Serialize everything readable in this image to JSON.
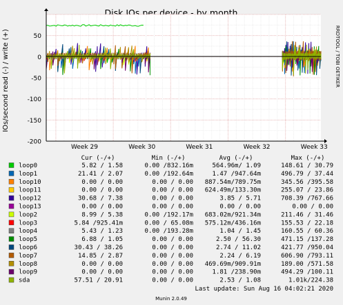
{
  "chart_data": {
    "type": "line",
    "title": "Disk IOs per device - by month",
    "ylabel": "IOs/second read (-) / write (+)",
    "side_label": "RRDTOOL / TOBI OETIKER",
    "ylim": [
      -200,
      100
    ],
    "yticks": [
      -200,
      -150,
      -100,
      -50,
      0,
      50
    ],
    "xticks": [
      "Week 29",
      "Week 30",
      "Week 31",
      "Week 32",
      "Week 33"
    ],
    "grid": true,
    "legend_header": {
      "cur": "Cur (-/+)",
      "min": "Min (-/+)",
      "avg": "Avg (-/+)",
      "max": "Max (-/+)"
    },
    "series": [
      {
        "name": "loop0",
        "color": "#00cc00",
        "cur": "5.82 / 1.58",
        "min": "0.00 /832.16m",
        "avg": "564.96m/ 1.09",
        "max": "148.61 / 30.79"
      },
      {
        "name": "loop1",
        "color": "#0066b3",
        "cur": "21.41 / 2.07",
        "min": "0.00 /192.64m",
        "avg": "1.47 /947.64m",
        "max": "496.79 / 37.44"
      },
      {
        "name": "loop10",
        "color": "#ff8000",
        "cur": "0.00 / 0.00",
        "min": "0.00 / 0.00",
        "avg": "887.54m/789.75m",
        "max": "345.56 /395.58"
      },
      {
        "name": "loop11",
        "color": "#ffcc00",
        "cur": "0.00 / 0.00",
        "min": "0.00 / 0.00",
        "avg": "624.49m/133.30m",
        "max": "255.07 / 23.86"
      },
      {
        "name": "loop12",
        "color": "#330099",
        "cur": "30.68 / 7.38",
        "min": "0.00 / 0.00",
        "avg": "3.85 / 5.71",
        "max": "708.39 /767.66"
      },
      {
        "name": "loop13",
        "color": "#990099",
        "cur": "0.00 / 0.00",
        "min": "0.00 / 0.00",
        "avg": "0.00 / 0.00",
        "max": "0.00 / 0.00"
      },
      {
        "name": "loop2",
        "color": "#ccff00",
        "cur": "8.99 / 5.38",
        "min": "0.00 /192.17m",
        "avg": "683.02m/921.34m",
        "max": "211.46 / 31.46"
      },
      {
        "name": "loop3",
        "color": "#ff0000",
        "cur": "5.84 /925.41m",
        "min": "0.00 / 65.08m",
        "avg": "575.12m/436.16m",
        "max": "155.53 / 22.18"
      },
      {
        "name": "loop4",
        "color": "#808080",
        "cur": "5.43 / 1.23",
        "min": "0.00 /193.28m",
        "avg": "1.04 / 1.45",
        "max": "160.55 / 60.36"
      },
      {
        "name": "loop5",
        "color": "#008f00",
        "cur": "6.88 / 1.05",
        "min": "0.00 / 0.00",
        "avg": "2.50 / 56.30",
        "max": "471.15 /137.28"
      },
      {
        "name": "loop6",
        "color": "#00487d",
        "cur": "30.43 / 38.26",
        "min": "0.00 / 0.00",
        "avg": "2.74 / 11.02",
        "max": "421.77 /950.04"
      },
      {
        "name": "loop7",
        "color": "#b35a00",
        "cur": "14.85 / 2.87",
        "min": "0.00 / 0.00",
        "avg": "2.24 / 6.19",
        "max": "606.90 /793.11"
      },
      {
        "name": "loop8",
        "color": "#b38f00",
        "cur": "0.00 / 0.00",
        "min": "0.00 / 0.00",
        "avg": "469.69m/909.91m",
        "max": "189.00 /571.58"
      },
      {
        "name": "loop9",
        "color": "#6b006b",
        "cur": "0.00 / 0.00",
        "min": "0.00 / 0.00",
        "avg": "1.81 /238.90m",
        "max": "494.29 /100.11"
      },
      {
        "name": "sda",
        "color": "#8fb300",
        "cur": "57.51 / 20.91",
        "min": "0.00 / 0.00",
        "avg": "2.53 / 1.08",
        "max": "1.01k/224.38"
      }
    ],
    "last_update": "Last update: Sun Aug 16 04:02:21 2020",
    "footer": "Munin 2.0.49"
  }
}
